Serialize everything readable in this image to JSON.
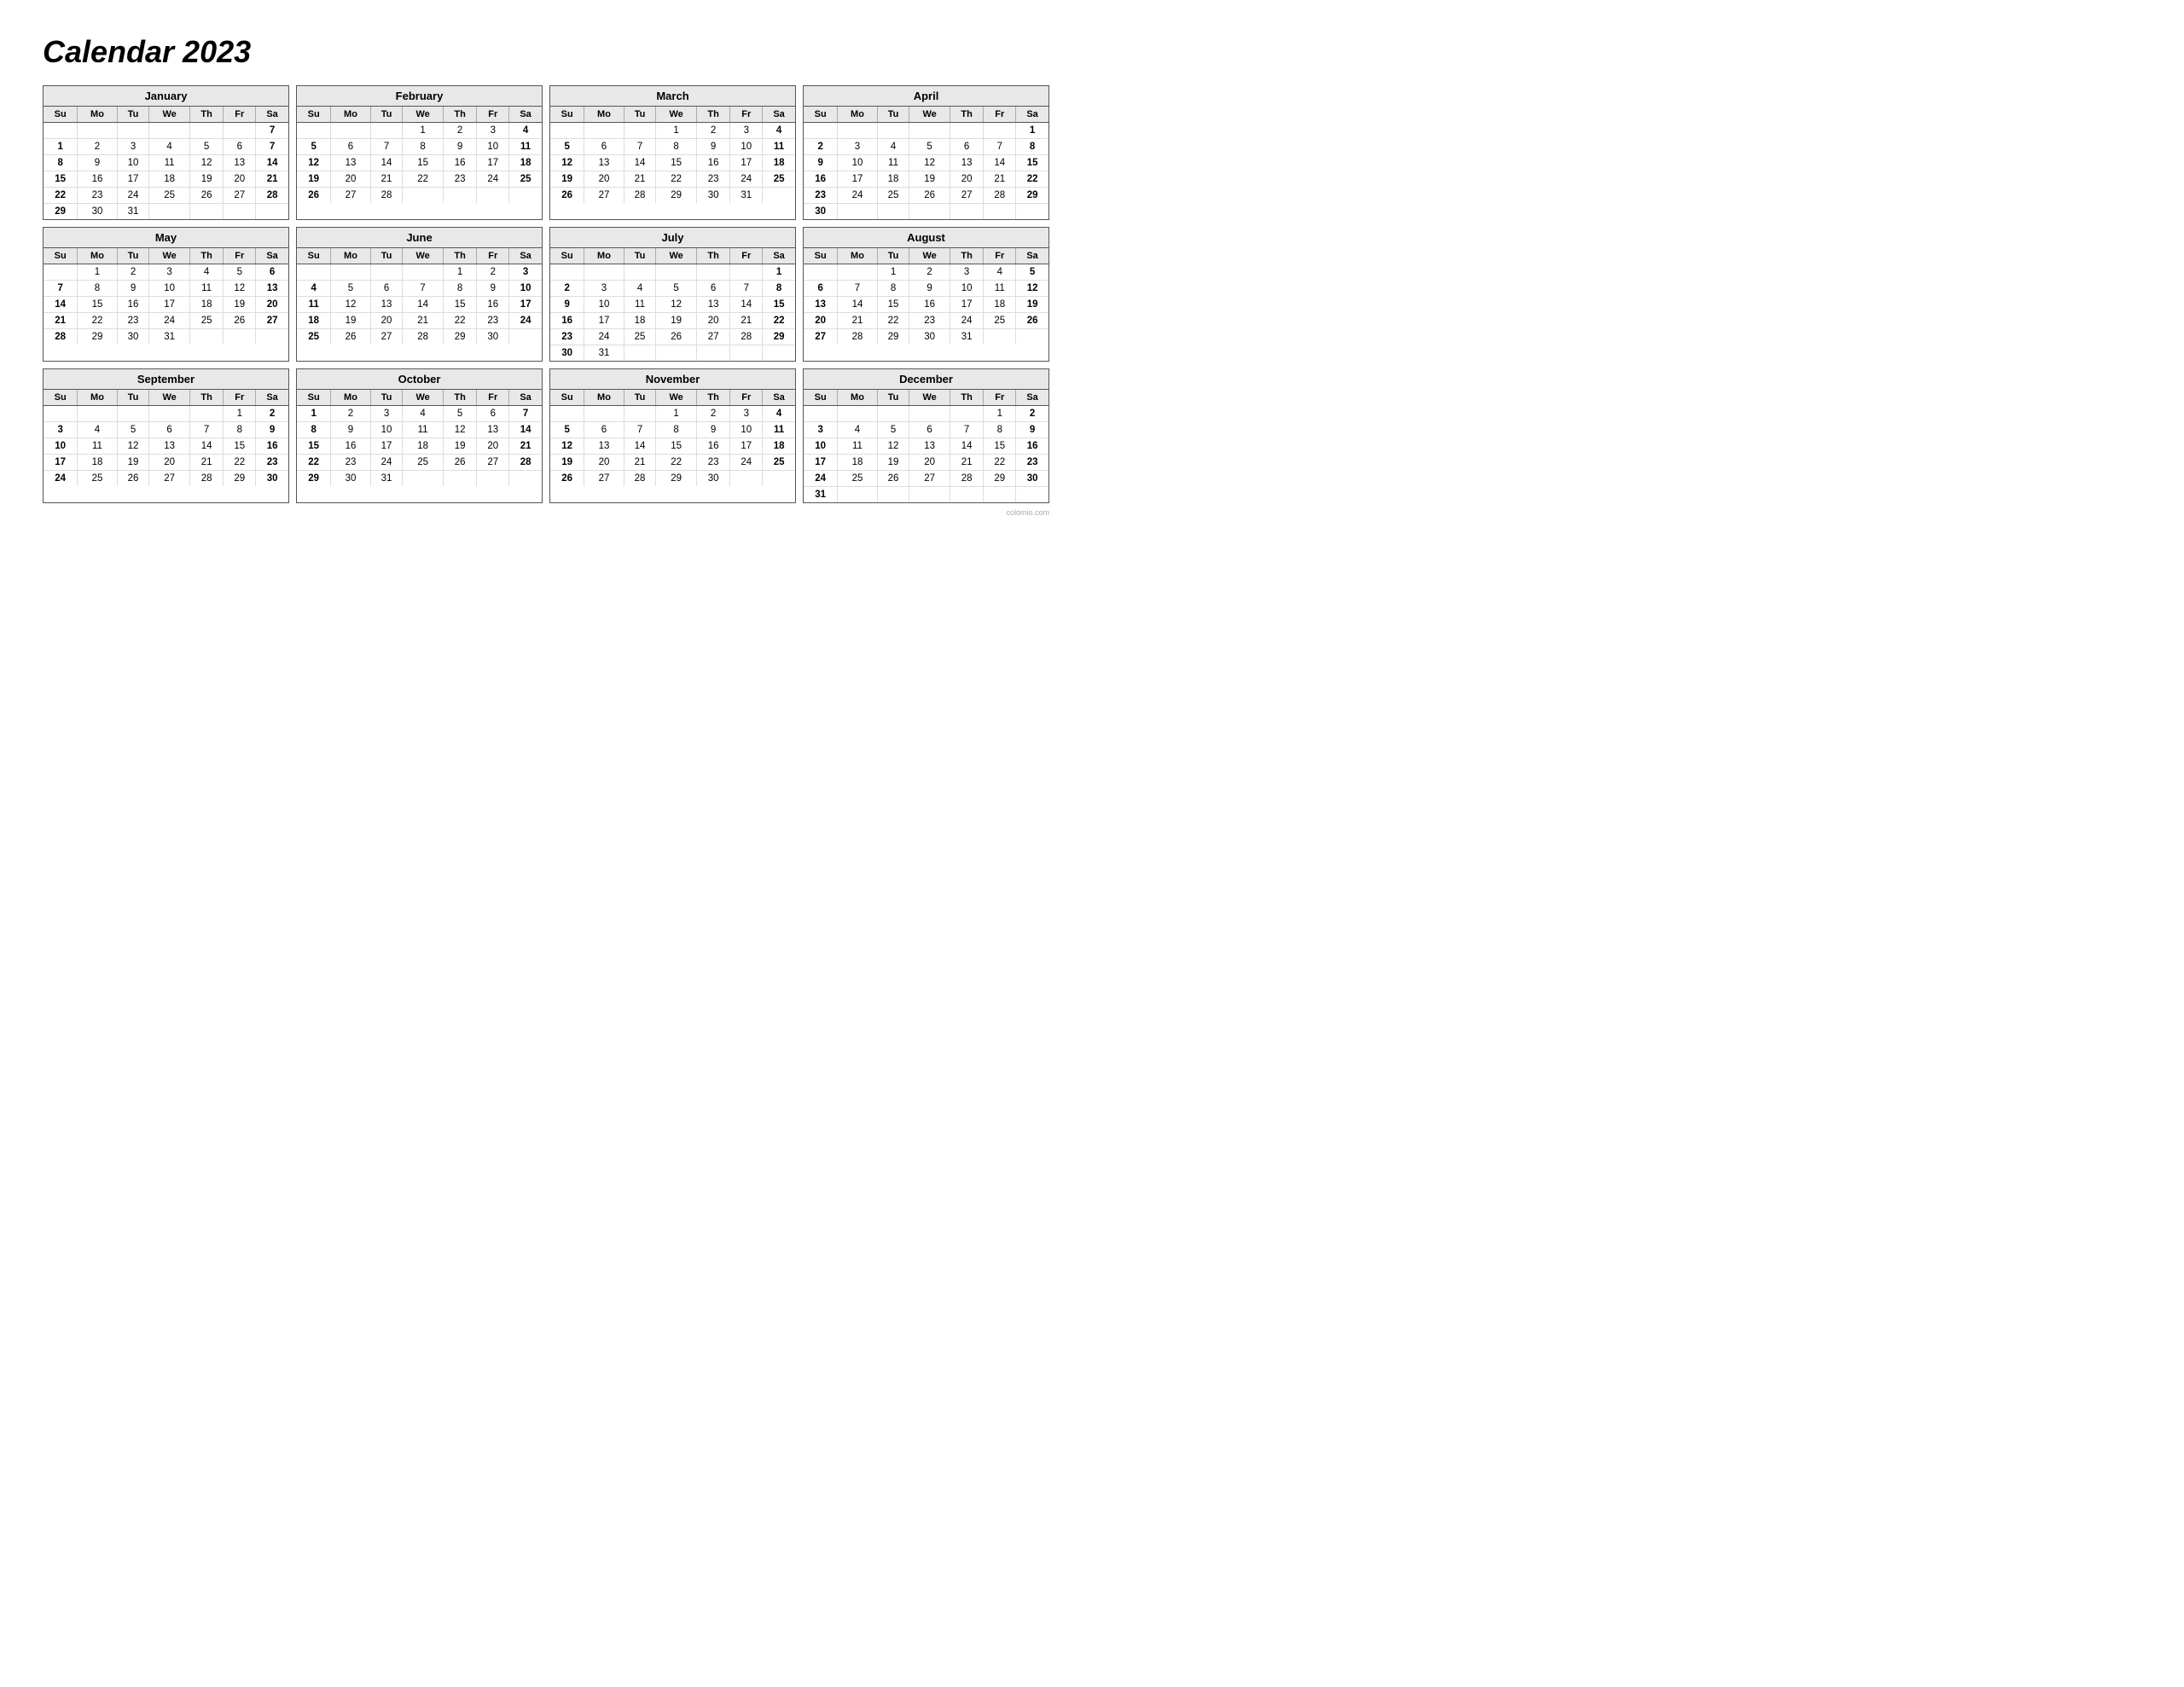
{
  "title": "Calendar 2023",
  "watermark": "colomio.com",
  "months": [
    {
      "name": "January",
      "weeks": [
        [
          "",
          "",
          "",
          "",
          "",
          "",
          "7"
        ],
        [
          "1",
          "2",
          "3",
          "4",
          "5",
          "6",
          "7"
        ],
        [
          "8",
          "9",
          "10",
          "11",
          "12",
          "13",
          "14"
        ],
        [
          "15",
          "16",
          "17",
          "18",
          "19",
          "20",
          "21"
        ],
        [
          "22",
          "23",
          "24",
          "25",
          "26",
          "27",
          "28"
        ],
        [
          "29",
          "30",
          "31",
          "",
          "",
          "",
          ""
        ]
      ],
      "bold_cols": [
        0,
        6
      ]
    },
    {
      "name": "February",
      "weeks": [
        [
          "",
          "",
          "",
          "1",
          "2",
          "3",
          "4"
        ],
        [
          "5",
          "6",
          "7",
          "8",
          "9",
          "10",
          "11"
        ],
        [
          "12",
          "13",
          "14",
          "15",
          "16",
          "17",
          "18"
        ],
        [
          "19",
          "20",
          "21",
          "22",
          "23",
          "24",
          "25"
        ],
        [
          "26",
          "27",
          "28",
          "",
          "",
          "",
          ""
        ]
      ],
      "bold_cols": [
        0,
        6
      ]
    },
    {
      "name": "March",
      "weeks": [
        [
          "",
          "",
          "",
          "1",
          "2",
          "3",
          "4"
        ],
        [
          "5",
          "6",
          "7",
          "8",
          "9",
          "10",
          "11"
        ],
        [
          "12",
          "13",
          "14",
          "15",
          "16",
          "17",
          "18"
        ],
        [
          "19",
          "20",
          "21",
          "22",
          "23",
          "24",
          "25"
        ],
        [
          "26",
          "27",
          "28",
          "29",
          "30",
          "31",
          ""
        ]
      ],
      "bold_cols": [
        0,
        6
      ]
    },
    {
      "name": "April",
      "weeks": [
        [
          "",
          "",
          "",
          "",
          "",
          "",
          "1"
        ],
        [
          "2",
          "3",
          "4",
          "5",
          "6",
          "7",
          "8"
        ],
        [
          "9",
          "10",
          "11",
          "12",
          "13",
          "14",
          "15"
        ],
        [
          "16",
          "17",
          "18",
          "19",
          "20",
          "21",
          "22"
        ],
        [
          "23",
          "24",
          "25",
          "26",
          "27",
          "28",
          "29"
        ],
        [
          "30",
          "",
          "",
          "",
          "",
          "",
          ""
        ]
      ],
      "bold_cols": [
        0,
        6
      ]
    },
    {
      "name": "May",
      "weeks": [
        [
          "",
          "1",
          "2",
          "3",
          "4",
          "5",
          "6"
        ],
        [
          "7",
          "8",
          "9",
          "10",
          "11",
          "12",
          "13"
        ],
        [
          "14",
          "15",
          "16",
          "17",
          "18",
          "19",
          "20"
        ],
        [
          "21",
          "22",
          "23",
          "24",
          "25",
          "26",
          "27"
        ],
        [
          "28",
          "29",
          "30",
          "31",
          "",
          "",
          ""
        ]
      ],
      "bold_cols": [
        0,
        6
      ]
    },
    {
      "name": "June",
      "weeks": [
        [
          "",
          "",
          "",
          "",
          "1",
          "2",
          "3"
        ],
        [
          "4",
          "5",
          "6",
          "7",
          "8",
          "9",
          "10"
        ],
        [
          "11",
          "12",
          "13",
          "14",
          "15",
          "16",
          "17"
        ],
        [
          "18",
          "19",
          "20",
          "21",
          "22",
          "23",
          "24"
        ],
        [
          "25",
          "26",
          "27",
          "28",
          "29",
          "30",
          ""
        ]
      ],
      "bold_cols": [
        0,
        6
      ]
    },
    {
      "name": "July",
      "weeks": [
        [
          "",
          "",
          "",
          "",
          "",
          "",
          "1"
        ],
        [
          "2",
          "3",
          "4",
          "5",
          "6",
          "7",
          "8"
        ],
        [
          "9",
          "10",
          "11",
          "12",
          "13",
          "14",
          "15"
        ],
        [
          "16",
          "17",
          "18",
          "19",
          "20",
          "21",
          "22"
        ],
        [
          "23",
          "24",
          "25",
          "26",
          "27",
          "28",
          "29"
        ],
        [
          "30",
          "31",
          "",
          "",
          "",
          "",
          ""
        ]
      ],
      "bold_cols": [
        0,
        6
      ]
    },
    {
      "name": "August",
      "weeks": [
        [
          "",
          "",
          "1",
          "2",
          "3",
          "4",
          "5"
        ],
        [
          "6",
          "7",
          "8",
          "9",
          "10",
          "11",
          "12"
        ],
        [
          "13",
          "14",
          "15",
          "16",
          "17",
          "18",
          "19"
        ],
        [
          "20",
          "21",
          "22",
          "23",
          "24",
          "25",
          "26"
        ],
        [
          "27",
          "28",
          "29",
          "30",
          "31",
          "",
          ""
        ]
      ],
      "bold_cols": [
        0,
        6
      ]
    },
    {
      "name": "September",
      "weeks": [
        [
          "",
          "",
          "",
          "",
          "",
          "1",
          "2"
        ],
        [
          "3",
          "4",
          "5",
          "6",
          "7",
          "8",
          "9"
        ],
        [
          "10",
          "11",
          "12",
          "13",
          "14",
          "15",
          "16"
        ],
        [
          "17",
          "18",
          "19",
          "20",
          "21",
          "22",
          "23"
        ],
        [
          "24",
          "25",
          "26",
          "27",
          "28",
          "29",
          "30"
        ]
      ],
      "bold_cols": [
        0,
        6
      ]
    },
    {
      "name": "October",
      "weeks": [
        [
          "1",
          "2",
          "3",
          "4",
          "5",
          "6",
          "7"
        ],
        [
          "8",
          "9",
          "10",
          "11",
          "12",
          "13",
          "14"
        ],
        [
          "15",
          "16",
          "17",
          "18",
          "19",
          "20",
          "21"
        ],
        [
          "22",
          "23",
          "24",
          "25",
          "26",
          "27",
          "28"
        ],
        [
          "29",
          "30",
          "31",
          "",
          "",
          "",
          ""
        ]
      ],
      "bold_cols": [
        0,
        6
      ]
    },
    {
      "name": "November",
      "weeks": [
        [
          "",
          "",
          "",
          "1",
          "2",
          "3",
          "4"
        ],
        [
          "5",
          "6",
          "7",
          "8",
          "9",
          "10",
          "11"
        ],
        [
          "12",
          "13",
          "14",
          "15",
          "16",
          "17",
          "18"
        ],
        [
          "19",
          "20",
          "21",
          "22",
          "23",
          "24",
          "25"
        ],
        [
          "26",
          "27",
          "28",
          "29",
          "30",
          "",
          ""
        ]
      ],
      "bold_cols": [
        0,
        6
      ]
    },
    {
      "name": "December",
      "weeks": [
        [
          "",
          "",
          "",
          "",
          "",
          "1",
          "2"
        ],
        [
          "3",
          "4",
          "5",
          "6",
          "7",
          "8",
          "9"
        ],
        [
          "10",
          "11",
          "12",
          "13",
          "14",
          "15",
          "16"
        ],
        [
          "17",
          "18",
          "19",
          "20",
          "21",
          "22",
          "23"
        ],
        [
          "24",
          "25",
          "26",
          "27",
          "28",
          "29",
          "30"
        ],
        [
          "31",
          "",
          "",
          "",
          "",
          "",
          ""
        ]
      ],
      "bold_cols": [
        0,
        6
      ]
    }
  ],
  "day_headers": [
    "Su",
    "Mo",
    "Tu",
    "We",
    "Th",
    "Fr",
    "Sa"
  ]
}
